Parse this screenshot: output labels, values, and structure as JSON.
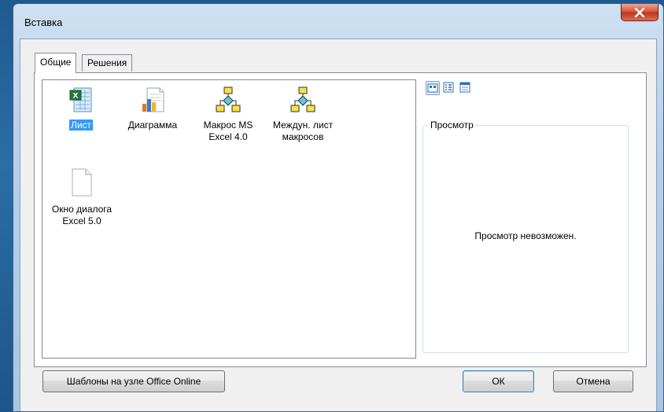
{
  "window": {
    "title": "Вставка",
    "close_label": "x"
  },
  "tabs": [
    {
      "label": "Общие",
      "active": true
    },
    {
      "label": "Решения",
      "active": false
    }
  ],
  "items": [
    {
      "label": "Лист",
      "icon": "excel-sheet-icon",
      "selected": true
    },
    {
      "label": "Диаграмма",
      "icon": "chart-icon",
      "selected": false
    },
    {
      "label": "Макрос MS Excel 4.0",
      "icon": "macro-icon",
      "selected": false
    },
    {
      "label": "Междун. лист макросов",
      "icon": "macro-icon",
      "selected": false
    },
    {
      "label": "Окно диалога Excel 5.0",
      "icon": "blank-document-icon",
      "selected": false
    }
  ],
  "items_display": {
    "item0": "Лист",
    "item1": "Диаграмма",
    "item2_line1": "Макрос MS",
    "item2_line2": "Excel 4.0",
    "item3_line1": "Междун. лист",
    "item3_line2": "макросов",
    "item4_line1": "Окно диалога",
    "item4_line2": "Excel 5.0"
  },
  "view_buttons": [
    "large-icons-view-icon",
    "list-view-icon",
    "details-view-icon"
  ],
  "preview": {
    "legend": "Просмотр",
    "message": "Просмотр невозможен."
  },
  "buttons": {
    "templates": "Шаблоны на узле Office Online",
    "ok": "ОК",
    "cancel": "Отмена"
  },
  "colors": {
    "selection": "#3399ff",
    "close_button": "#c1361f",
    "title_bar": "#b9d1ea"
  }
}
